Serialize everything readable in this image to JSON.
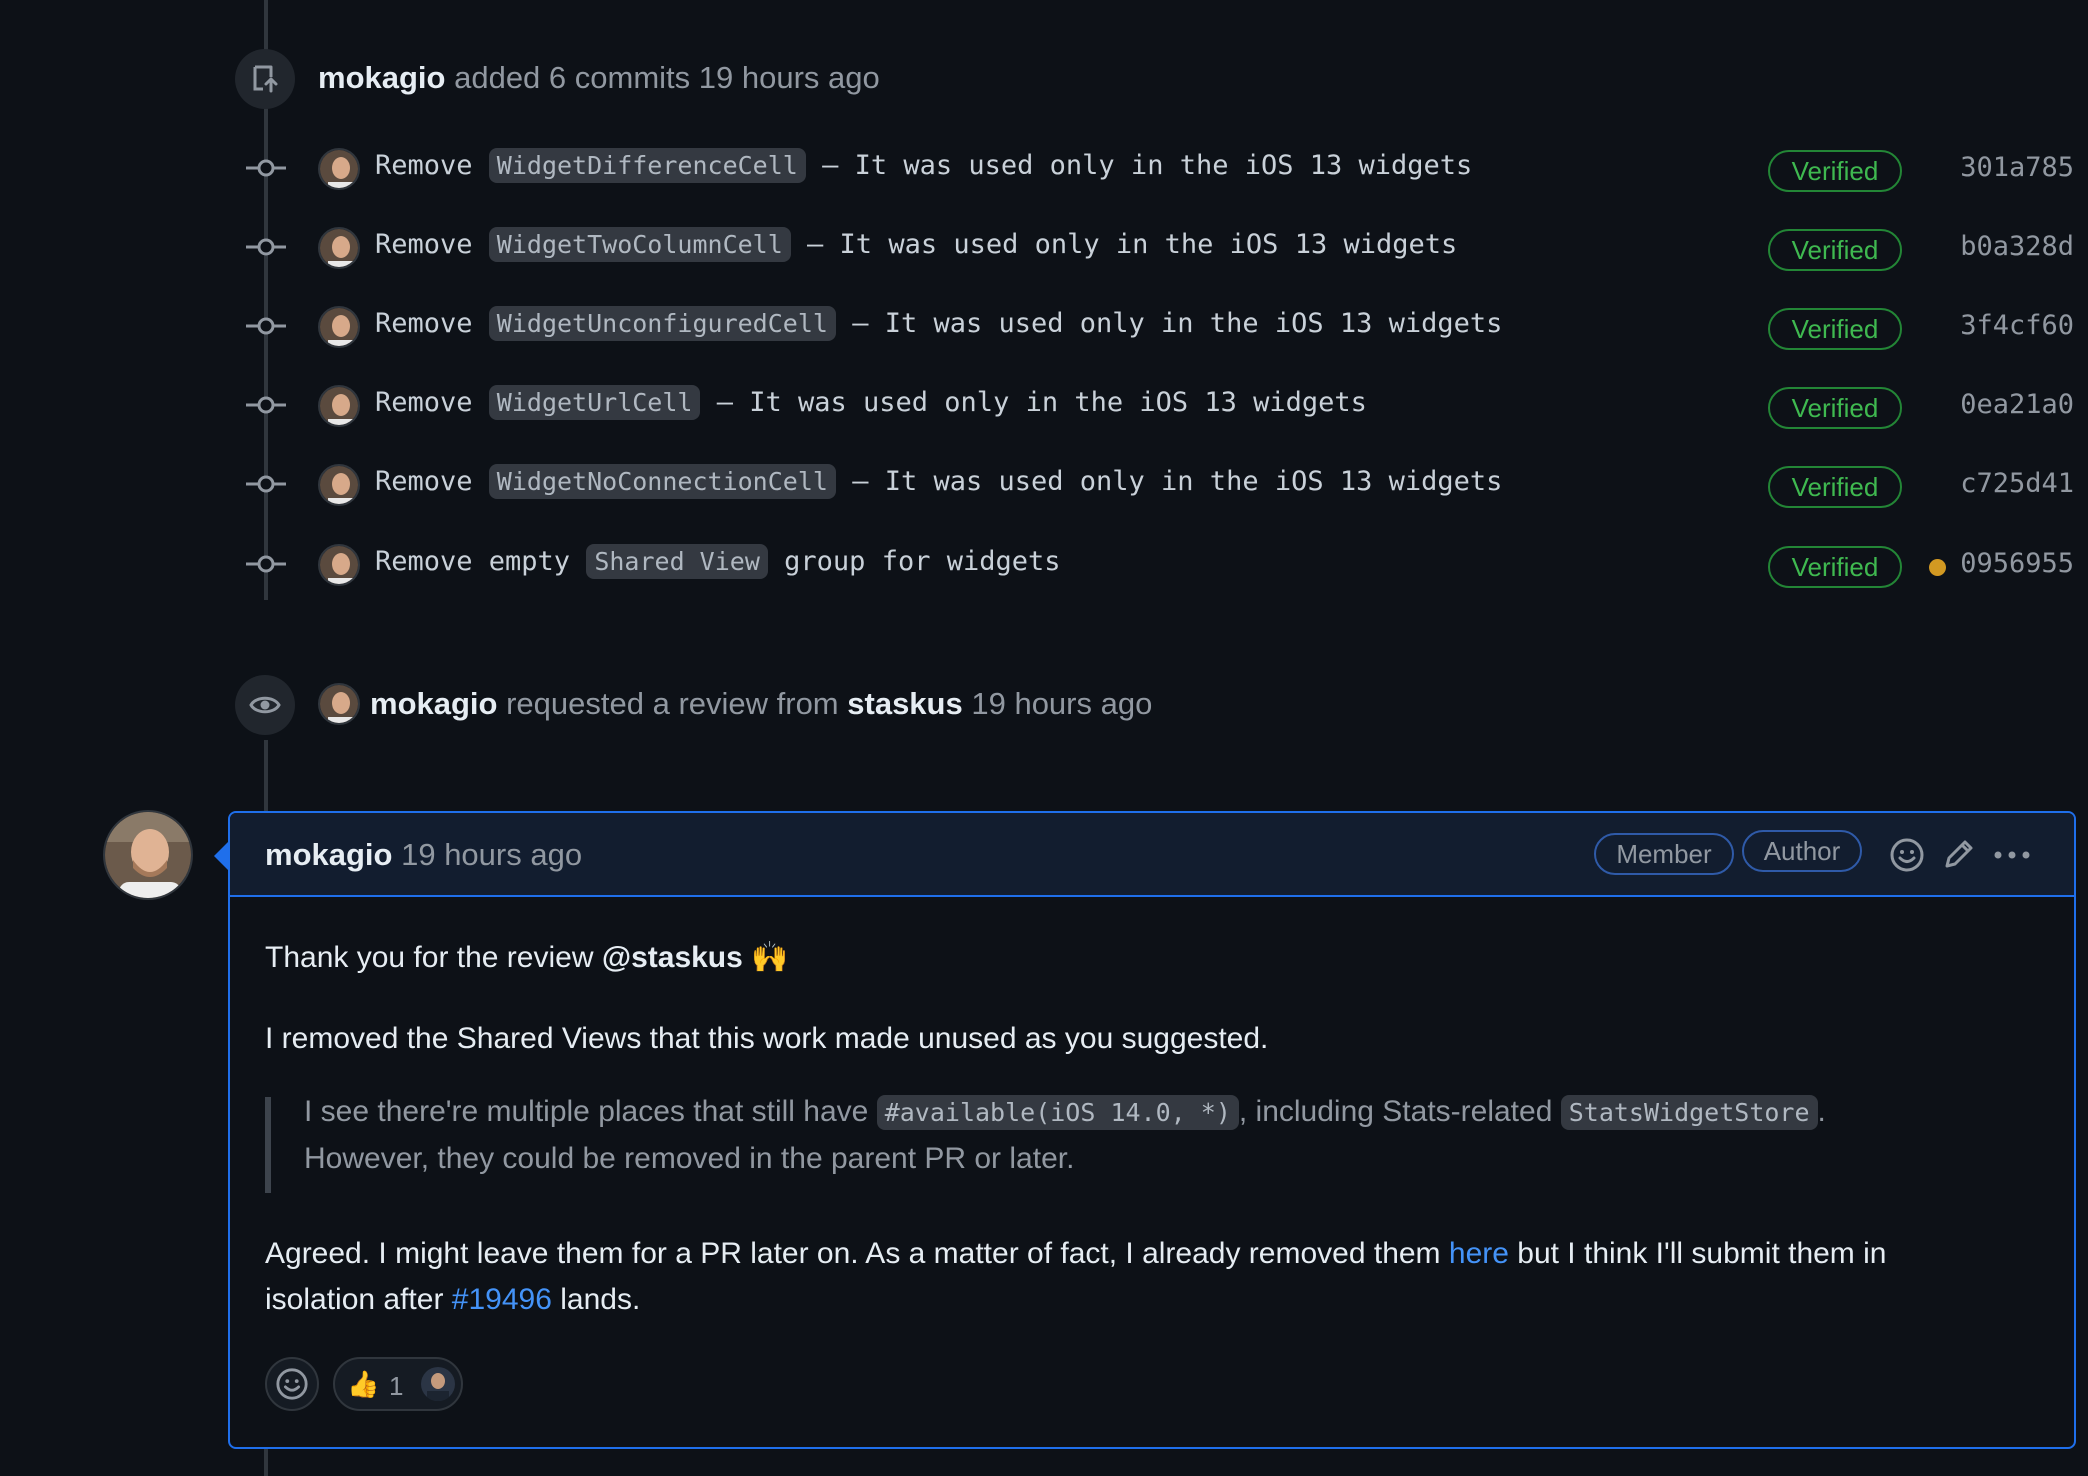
{
  "commits_event": {
    "author": "mokagio",
    "action": "added 6 commits",
    "time": "19 hours ago"
  },
  "commits": [
    {
      "prefix": "Remove ",
      "code": "WidgetDifferenceCell",
      "suffix": " — It was used only in the iOS 13 widgets",
      "verified": "Verified",
      "sha": "301a785"
    },
    {
      "prefix": "Remove ",
      "code": "WidgetTwoColumnCell",
      "suffix": " — It was used only in the iOS 13 widgets",
      "verified": "Verified",
      "sha": "b0a328d"
    },
    {
      "prefix": "Remove ",
      "code": "WidgetUnconfiguredCell",
      "suffix": " — It was used only in the iOS 13 widgets",
      "verified": "Verified",
      "sha": "3f4cf60"
    },
    {
      "prefix": "Remove ",
      "code": "WidgetUrlCell",
      "suffix": " — It was used only in the iOS 13 widgets",
      "verified": "Verified",
      "sha": "0ea21a0"
    },
    {
      "prefix": "Remove ",
      "code": "WidgetNoConnectionCell",
      "suffix": " — It was used only in the iOS 13 widgets",
      "verified": "Verified",
      "sha": "c725d41"
    },
    {
      "prefix": "Remove empty ",
      "code": "Shared View",
      "suffix": " group for widgets",
      "verified": "Verified",
      "sha": "0956955",
      "status": "pending"
    }
  ],
  "review_event": {
    "author": "mokagio",
    "action": "requested a review from",
    "reviewer": "staskus",
    "time": "19 hours ago"
  },
  "comment": {
    "author": "mokagio",
    "time": "19 hours ago",
    "badges": [
      "Member",
      "Author"
    ],
    "para1_text": "Thank you for the review ",
    "para1_mention": "@staskus",
    "para1_emoji": "🙌",
    "para2": "I removed the Shared Views that this work made unused as you suggested.",
    "quote_line1_a": "I see there're multiple places that still have ",
    "quote_line1_code1": "#available(iOS 14.0, *)",
    "quote_line1_b": ", including Stats-related ",
    "quote_line1_code2": "StatsWidgetStore",
    "quote_line1_c": ".",
    "quote_line2": "However, they could be removed in the parent PR or later.",
    "para3_a": "Agreed. I might leave them for a PR later on. As a matter of fact, I already removed them ",
    "para3_link": "here",
    "para3_b": " but I think I'll submit them in",
    "para4_a": "isolation after ",
    "para4_link": "#19496",
    "para4_b": " lands.",
    "reaction": {
      "emoji": "👍",
      "count": "1"
    }
  },
  "colors": {
    "background": "#0d1117",
    "verified_green": "#3fb950",
    "link_blue": "#4493f8",
    "pending_dot": "#d29922",
    "comment_border": "#1f6feb"
  },
  "icons": [
    "push-icon",
    "commit-node-icon",
    "eye-icon",
    "smiley-icon",
    "pencil-icon",
    "kebab-icon",
    "add-reaction-icon"
  ]
}
